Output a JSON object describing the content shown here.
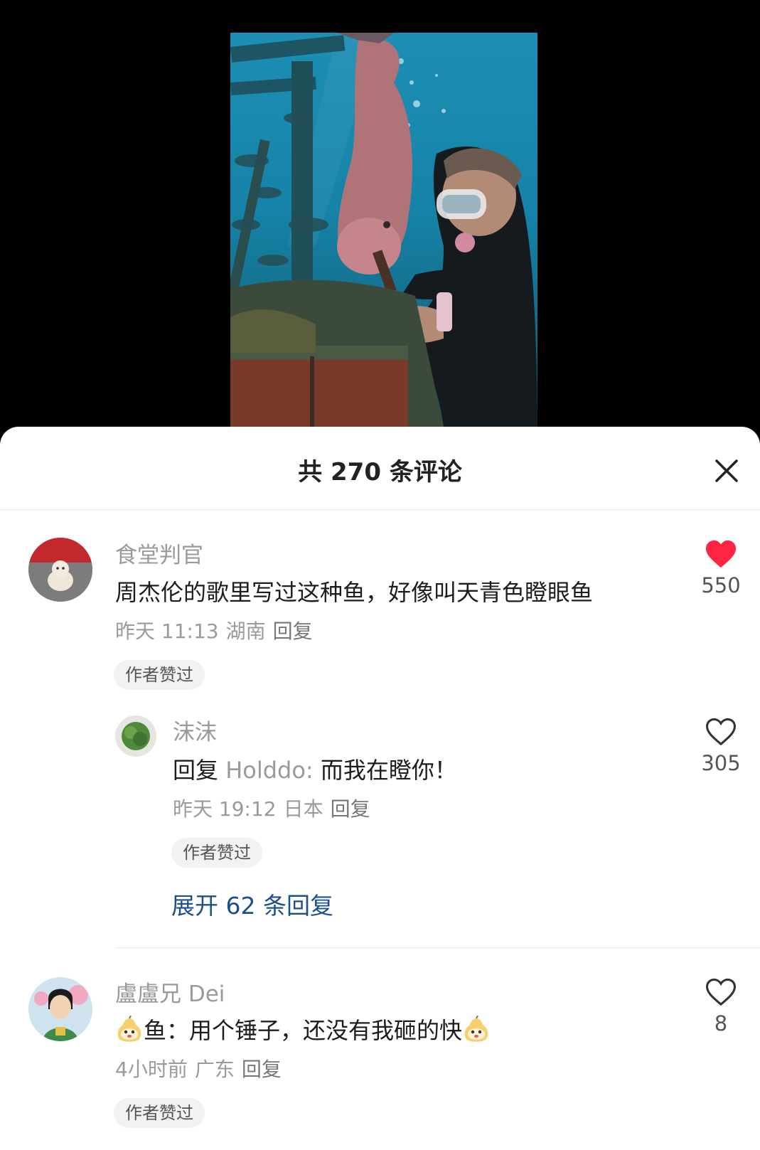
{
  "sheet": {
    "title": "共 270 条评论",
    "close_icon": "close-icon"
  },
  "comments": [
    {
      "username": "食堂判官",
      "text": "周杰伦的歌里写过这种鱼，好像叫天青色瞪眼鱼",
      "time": "昨天 11:13",
      "location": "湖南",
      "reply_label": "回复",
      "badge": "作者赞过",
      "likes": "550",
      "liked": true,
      "like_color": "#ff2442"
    },
    {
      "username": "沫沫",
      "reply_prefix": "回复",
      "reply_to": "Holddo:",
      "text": " 而我在瞪你！",
      "time": "昨天 19:12",
      "location": "日本",
      "reply_label": "回复",
      "badge": "作者赞过",
      "likes": "305",
      "liked": false
    },
    {
      "username": "盧盧兄 Dei",
      "text": "鱼：用个锤子，还没有我砸的快",
      "emoji_icon": "pear-face-emoji-icon",
      "time": "4小时前",
      "location": "广东",
      "reply_label": "回复",
      "badge": "作者赞过",
      "likes": "8",
      "liked": false
    }
  ],
  "expand_replies": "展开 62 条回复",
  "colors": {
    "link_blue": "#1d4f8c",
    "like_red": "#ff2442",
    "muted_gray": "#9a9a9a"
  }
}
